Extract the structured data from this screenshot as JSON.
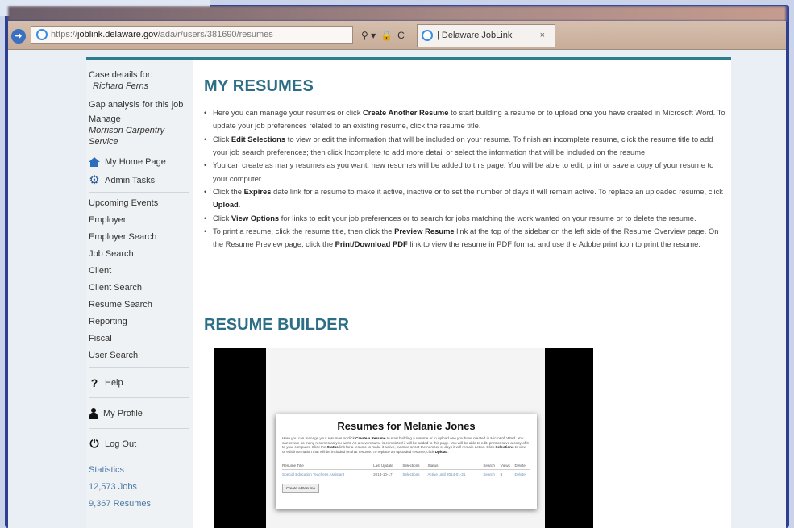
{
  "browser": {
    "url_prefix": "https://",
    "url_domain": "joblink.delaware.gov",
    "url_path": "/ada/r/users/381690/resumes",
    "addr_tools": [
      "⚲ ▾",
      "🔒",
      "C"
    ],
    "tab_title": "| Delaware JobLink",
    "tab_close": "×",
    "back_glyph": "➜"
  },
  "sidebar": {
    "case_label": "Case details for:",
    "case_name": "Richard Ferns",
    "gap_analysis": "Gap analysis for this job",
    "manage_label": "Manage",
    "manage_name": "Morrison Carpentry Service",
    "home": "My Home Page",
    "admin": "Admin Tasks",
    "items": [
      "Upcoming Events",
      "Employer",
      "Employer Search",
      "Job Search",
      "Client",
      "Client Search",
      "Resume Search",
      "Reporting",
      "Fiscal",
      "User Search"
    ],
    "help": "Help",
    "help_glyph": "?",
    "profile": "My Profile",
    "logout": "Log Out",
    "logout_glyph": "⏻",
    "stats_label": "Statistics",
    "jobs": "12,573 Jobs",
    "resumes": "9,367 Resumes"
  },
  "main": {
    "title": "MY RESUMES",
    "bullets": [
      {
        "a": "Here you can manage your resumes or click ",
        "b": "Create Another Resume",
        "c": " to start building a resume or to upload one you have created in Microsoft Word. To update your job preferences related to an existing resume, click the resume title."
      },
      {
        "a": "Click ",
        "b": "Edit Selections",
        "c": " to view or edit the information that will be included on your resume. To finish an incomplete resume, click the resume title to add your job search preferences; then click Incomplete to add more detail or select the information that will be included on the resume."
      },
      {
        "a": "You can create as many resumes as you want; new resumes will be added to this page. You will be able to edit, print or save a copy of your resume to your computer.",
        "b": "",
        "c": ""
      },
      {
        "a": "Click the ",
        "b": "Expires",
        "c": " date link for a resume to make it active, inactive or to set the number of days it will remain active. To replace an uploaded resume, click ",
        "d": "Upload",
        "e": "."
      },
      {
        "a": "Click ",
        "b": "View Options",
        "c": " for links to edit your job preferences or to search for jobs matching the work wanted on your resume or to delete the resume."
      },
      {
        "a": "To print a resume, click the resume title, then click the ",
        "b": "Preview Resume",
        "c": " link at the top of the sidebar on the left side of the Resume Overview page. On the Resume Preview page, click the ",
        "d": "Print/Download PDF",
        "e": " link to view the resume in PDF format and use the Adobe print icon to print the resume."
      }
    ],
    "builder_title": "RESUME BUILDER",
    "video": {
      "title": "Resumes for Melanie Jones",
      "text_a": "Here you can manage your resumes or click ",
      "text_b": "Create a Resume",
      "text_c": " to start building a resume or to upload one you have created in Microsoft Word. You can create as many resumes as you want. As a new resume is completed it will be added to this page. You will be able to edit, print or save a copy of it to your computer. Click the ",
      "text_d": "Status",
      "text_e": " link for a resume to make it active, inactive or set the number of days it will remain active. Click ",
      "text_f": "Selections",
      "text_g": " to view or edit information that will be included on that resume. To replace an uploaded resume, click ",
      "text_h": "Upload",
      "text_i": ".",
      "headers": [
        "Resume Title",
        "Last Update",
        "Selections",
        "Status",
        "Search",
        "Views",
        "Delete"
      ],
      "row": [
        "Special Education Teacher's Assistant",
        "2013-10-17",
        "Selections",
        "Active until 2014-01-21",
        "Search",
        "8",
        "Delete"
      ],
      "button": "Create a Resume"
    }
  }
}
